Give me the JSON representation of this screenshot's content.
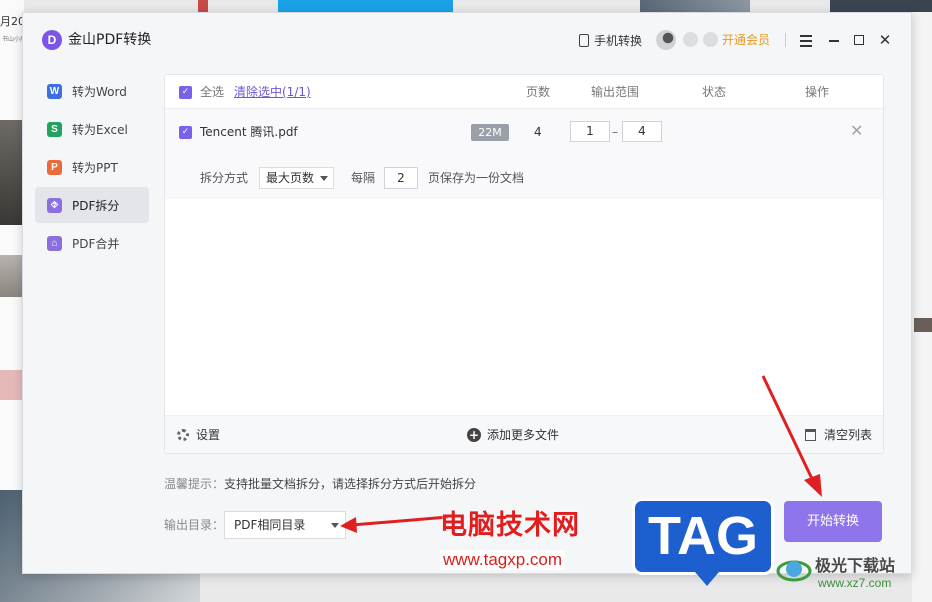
{
  "background": {
    "left_text": "月20",
    "left_sub": "书山小展"
  },
  "titlebar": {
    "logo_letter": "D",
    "app_title": "金山PDF转换",
    "mobile_convert": "手机转换",
    "vip_label": "开通会员"
  },
  "sidebar": {
    "items": [
      {
        "label": "转为Word",
        "icon": "W",
        "color": "#3e6fe0",
        "active": false
      },
      {
        "label": "转为Excel",
        "icon": "S",
        "color": "#22a45d",
        "active": false
      },
      {
        "label": "转为PPT",
        "icon": "P",
        "color": "#ea6a3a",
        "active": false
      },
      {
        "label": "PDF拆分",
        "icon": "⯑",
        "color": "#8b6fe0",
        "active": true
      },
      {
        "label": "PDF合并",
        "icon": "⌂",
        "color": "#8b6fe0",
        "active": false
      }
    ]
  },
  "table": {
    "select_all": "全选",
    "clear_selected": "清除选中(1/1)",
    "col_pages": "页数",
    "col_range": "输出范围",
    "col_status": "状态",
    "col_ops": "操作"
  },
  "file": {
    "name": "Tencent 腾讯.pdf",
    "size": "22M",
    "pages": "4",
    "range_from": "1",
    "range_sep": "–",
    "range_to": "4",
    "delete": "✕"
  },
  "split": {
    "mode_label": "拆分方式",
    "mode_value": "最大页数",
    "every_label": "每隔",
    "every_value": "2",
    "every_suffix": "页保存为一份文档"
  },
  "footer": {
    "settings": "设置",
    "add_more": "添加更多文件",
    "clear_list": "清空列表"
  },
  "tip": {
    "label": "温馨提示：",
    "text": "支持批量文档拆分，请选择拆分方式后开始拆分"
  },
  "output": {
    "label": "输出目录：",
    "value": "PDF相同目录"
  },
  "start_button": "开始转换",
  "watermark": {
    "cn_text": "电脑技术网",
    "url": "www.tagxp.com",
    "tag": "TAG",
    "jg_name": "极光下载站",
    "jg_url": "www.xz7.com"
  },
  "colors": {
    "accent": "#7b61e8",
    "start_button": "#8e75ec",
    "vip": "#e39a25",
    "annotation_arrow": "#e02020"
  }
}
